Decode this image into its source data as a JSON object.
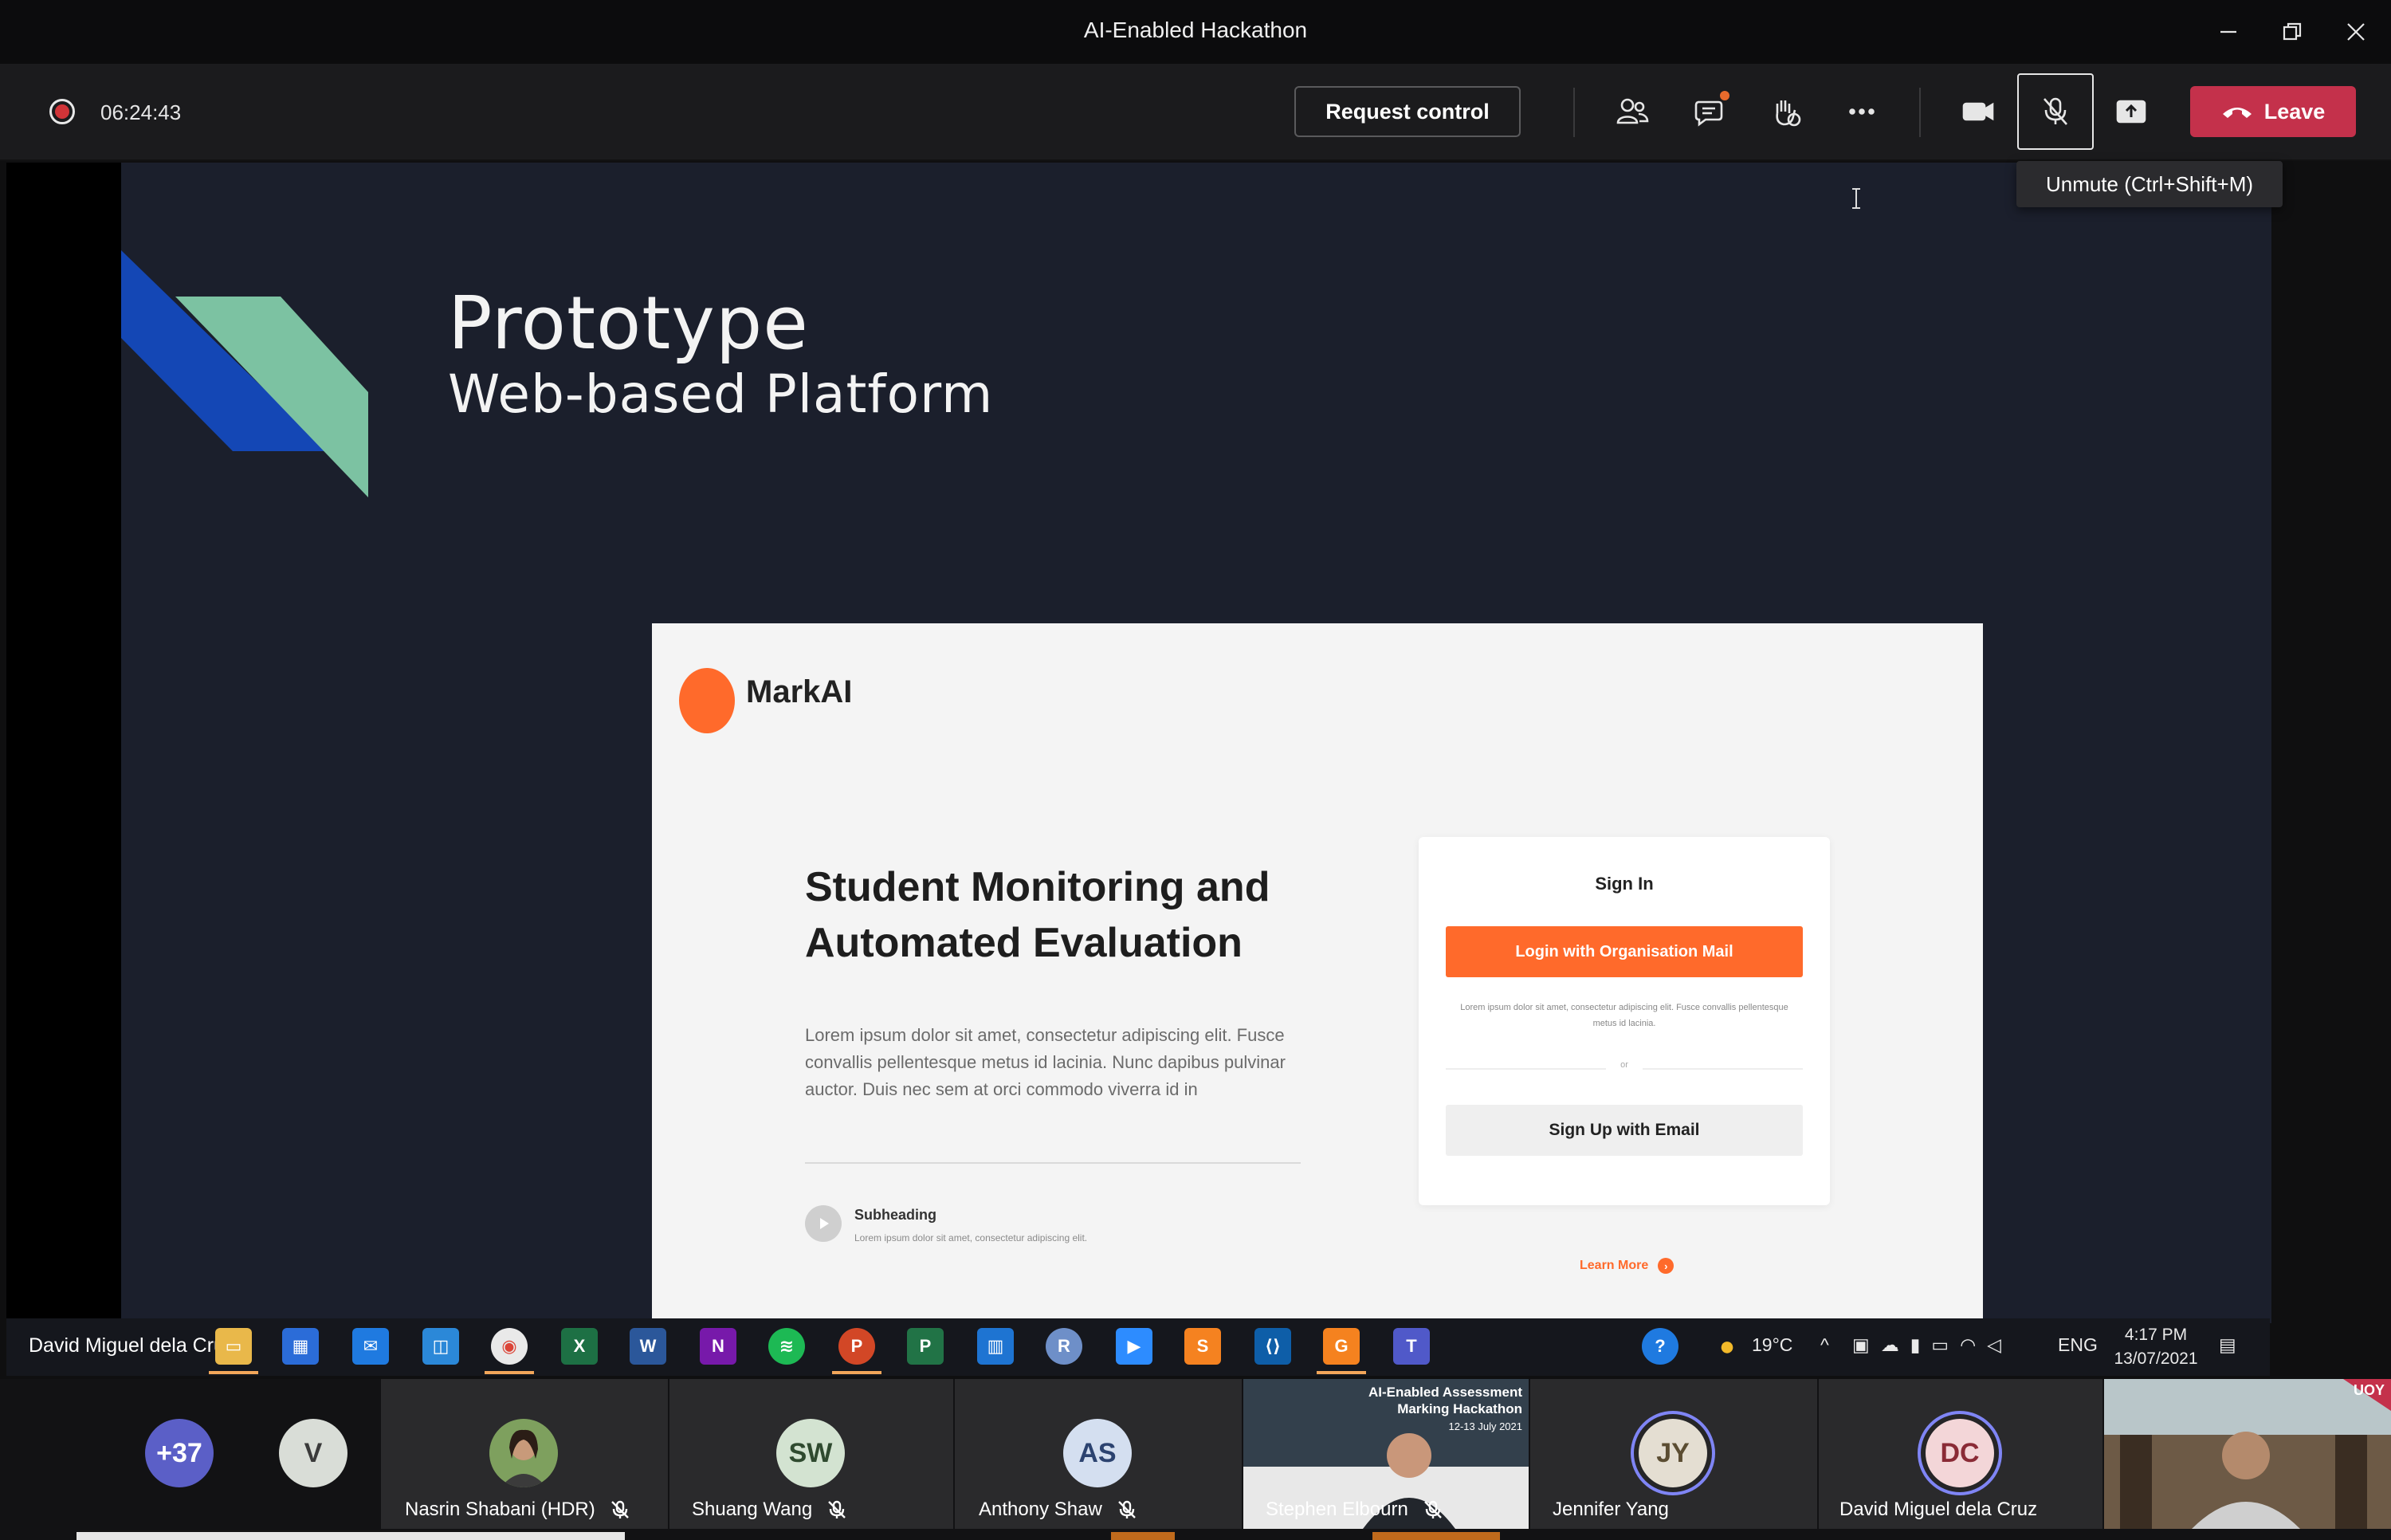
{
  "window": {
    "title": "AI-Enabled Hackathon"
  },
  "toolbar": {
    "recording_time": "06:24:43",
    "request_control_label": "Request control",
    "leave_label": "Leave",
    "mic_tooltip": "Unmute (Ctrl+Shift+M)"
  },
  "slide": {
    "title": "Prototype",
    "subtitle": "Web-based Platform",
    "mockup": {
      "brand": "MarkAI",
      "heading": "Student Monitoring and Automated Evaluation",
      "body": "Lorem ipsum dolor sit amet, consectetur adipiscing elit. Fusce convallis pellentesque metus id lacinia. Nunc dapibus pulvinar auctor. Duis nec sem at orci commodo viverra id in",
      "subheading": "Subheading",
      "subheading_text": "Lorem ipsum dolor sit amet, consectetur adipiscing elit.",
      "signin_title": "Sign In",
      "login_org_label": "Login with Organisation Mail",
      "signin_note": "Lorem ipsum dolor sit amet, consectetur adipiscing elit. Fusce convallis pellentesque metus id lacinia.",
      "or_label": "or",
      "signup_email_label": "Sign Up with Email",
      "learn_more_label": "Learn More"
    }
  },
  "presenter_taskbar": {
    "presenter_name": "David Miguel dela Cruz",
    "weather": "19°C",
    "language": "ENG",
    "time": "4:17 PM",
    "date": "13/07/2021"
  },
  "participants": {
    "overflow_count": "+37",
    "v_initial": "V",
    "list": [
      {
        "name": "Nasrin Shabani (HDR)"
      },
      {
        "initials": "SW",
        "name": "Shuang Wang"
      },
      {
        "initials": "AS",
        "name": "Anthony Shaw"
      },
      {
        "name": "Stephen Elbourn"
      },
      {
        "initials": "JY",
        "name": "Jennifer Yang"
      },
      {
        "initials": "DC",
        "name": "David Miguel dela Cruz"
      }
    ],
    "stephen_banner_title": "AI-Enabled Assessment Marking Hackathon",
    "stephen_banner_dates": "12-13 July 2021",
    "last_tile_badge": "UOY"
  },
  "colors": {
    "leave": "#c4314b",
    "accent_orange": "#ff6a2b",
    "recording": "#d13438",
    "speaker_ring": "#7f85f5"
  },
  "icons": [
    "participants-icon",
    "chat-icon",
    "reactions-icon",
    "more-icon",
    "camera-icon",
    "mic-off-icon",
    "share-icon",
    "phone-icon"
  ]
}
